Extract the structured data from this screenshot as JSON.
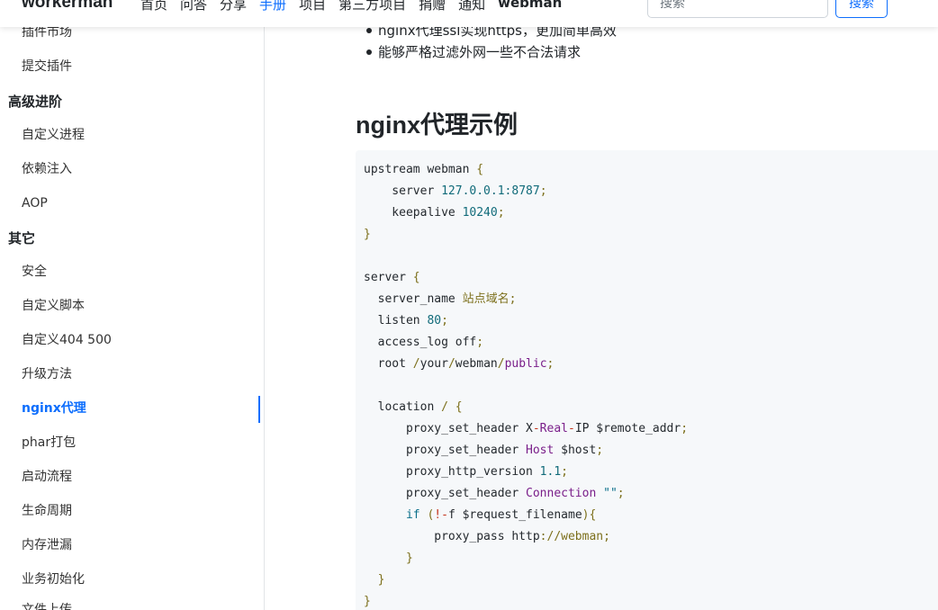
{
  "navbar": {
    "brand": "workerman",
    "links": [
      {
        "label": "首页"
      },
      {
        "label": "问答"
      },
      {
        "label": "分享"
      },
      {
        "label": "手册"
      },
      {
        "label": "项目"
      },
      {
        "label": "第三方项目"
      },
      {
        "label": "捐赠"
      },
      {
        "label": "通知"
      },
      {
        "label": "webman"
      }
    ],
    "active_link": "手册",
    "search_placeholder": "搜索",
    "search_button": "搜索"
  },
  "sidebar": {
    "items": [
      {
        "label": "插件市场",
        "type": "item"
      },
      {
        "label": "提交插件",
        "type": "item"
      },
      {
        "label": "高级进阶",
        "type": "header"
      },
      {
        "label": "自定义进程",
        "type": "item"
      },
      {
        "label": "依赖注入",
        "type": "item"
      },
      {
        "label": "AOP",
        "type": "item"
      },
      {
        "label": "其它",
        "type": "header"
      },
      {
        "label": "安全",
        "type": "item"
      },
      {
        "label": "自定义脚本",
        "type": "item"
      },
      {
        "label": "自定义404 500",
        "type": "item"
      },
      {
        "label": "升级方法",
        "type": "item"
      },
      {
        "label": "nginx代理",
        "type": "item",
        "active": true
      },
      {
        "label": "phar打包",
        "type": "item"
      },
      {
        "label": "启动流程",
        "type": "item"
      },
      {
        "label": "生命周期",
        "type": "item"
      },
      {
        "label": "内存泄漏",
        "type": "item"
      },
      {
        "label": "业务初始化",
        "type": "item"
      },
      {
        "label": "文件上传",
        "type": "item"
      }
    ]
  },
  "content": {
    "features": [
      "nginx代理ssl实现https，更加简单高效",
      "能够严格过滤外网一些不合法请求"
    ],
    "section_title": "nginx代理示例",
    "code_lines": [
      [
        [
          "upstream webman ",
          ""
        ],
        [
          "{",
          "brace"
        ]
      ],
      [
        [
          "    server ",
          ""
        ],
        [
          "127.0.0.1",
          "num"
        ],
        [
          ":",
          "num"
        ],
        [
          "8787",
          "num"
        ],
        [
          ";",
          "brace"
        ]
      ],
      [
        [
          "    keepalive ",
          ""
        ],
        [
          "10240",
          "num"
        ],
        [
          ";",
          "brace"
        ]
      ],
      [
        [
          "}",
          "brace"
        ]
      ],
      [
        [
          "",
          ""
        ]
      ],
      [
        [
          "server ",
          ""
        ],
        [
          "{",
          "brace"
        ]
      ],
      [
        [
          "  server_name ",
          ""
        ],
        [
          "站点域名",
          "brace"
        ],
        [
          ";",
          "brace"
        ]
      ],
      [
        [
          "  listen ",
          ""
        ],
        [
          "80",
          "num"
        ],
        [
          ";",
          "brace"
        ]
      ],
      [
        [
          "  access_log off",
          ""
        ],
        [
          ";",
          "brace"
        ]
      ],
      [
        [
          "  root ",
          ""
        ],
        [
          "/",
          "brace"
        ],
        [
          "your",
          ""
        ],
        [
          "/",
          "brace"
        ],
        [
          "webman",
          ""
        ],
        [
          "/",
          "brace"
        ],
        [
          "public",
          "kw"
        ],
        [
          ";",
          "brace"
        ]
      ],
      [
        [
          "",
          ""
        ]
      ],
      [
        [
          "  location ",
          ""
        ],
        [
          "/",
          "brace"
        ],
        [
          " ",
          ""
        ],
        [
          "{",
          "brace"
        ]
      ],
      [
        [
          "      proxy_set_header X",
          ""
        ],
        [
          "-",
          "op"
        ],
        [
          "Real",
          "kw"
        ],
        [
          "-",
          "op"
        ],
        [
          "IP $remote_addr",
          ""
        ],
        [
          ";",
          "brace"
        ]
      ],
      [
        [
          "      proxy_set_header ",
          ""
        ],
        [
          "Host",
          "kw"
        ],
        [
          " $host",
          ""
        ],
        [
          ";",
          "brace"
        ]
      ],
      [
        [
          "      proxy_http_version ",
          ""
        ],
        [
          "1.1",
          "num"
        ],
        [
          ";",
          "brace"
        ]
      ],
      [
        [
          "      proxy_set_header ",
          ""
        ],
        [
          "Connection",
          "kw"
        ],
        [
          " ",
          ""
        ],
        [
          "\"\"",
          "str"
        ],
        [
          ";",
          "brace"
        ]
      ],
      [
        [
          "      ",
          ""
        ],
        [
          "if",
          "str"
        ],
        [
          " ",
          ""
        ],
        [
          "(",
          "brace"
        ],
        [
          "!",
          "op"
        ],
        [
          "-",
          "op"
        ],
        [
          "f $request_filename",
          ""
        ],
        [
          ")",
          "brace"
        ],
        [
          "{",
          "brace"
        ]
      ],
      [
        [
          "          proxy_pass http",
          ""
        ],
        [
          ":",
          "brace"
        ],
        [
          "//",
          "brace"
        ],
        [
          "webman",
          "brace"
        ],
        [
          ";",
          "brace"
        ]
      ],
      [
        [
          "      ",
          ""
        ],
        [
          "}",
          "brace"
        ]
      ],
      [
        [
          "  ",
          ""
        ],
        [
          "}",
          "brace"
        ]
      ],
      [
        [
          "}",
          "brace"
        ]
      ]
    ]
  },
  "colors": {
    "accent": "#0d6efd",
    "code_background": "#f6f8fa"
  }
}
